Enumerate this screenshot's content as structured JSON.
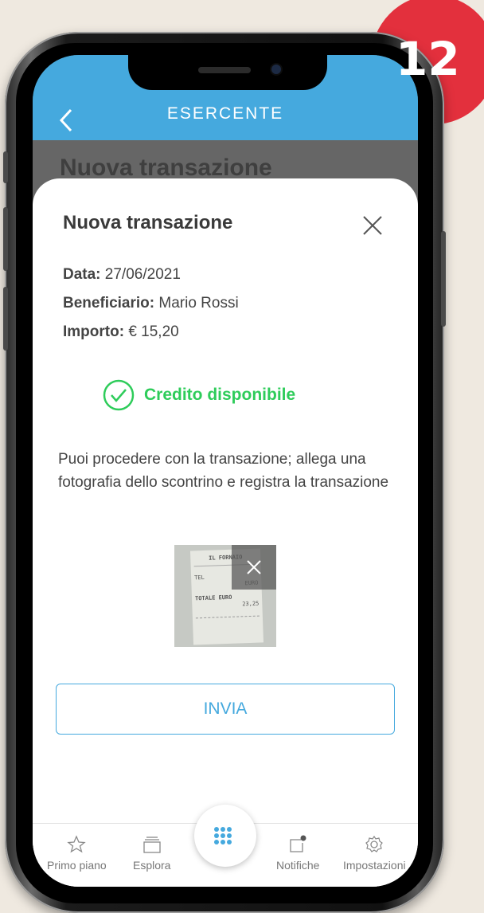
{
  "header": {
    "title": "ESERCENTE"
  },
  "background_title": "Nuova transazione",
  "modal": {
    "title": "Nuova transazione",
    "date_label": "Data:",
    "date_value": "27/06/2021",
    "beneficiary_label": "Beneficiario:",
    "beneficiary_value": "Mario Rossi",
    "amount_label": "Importo:",
    "amount_value": "€ 15,20",
    "status": "Credito disponibile",
    "description": "Puoi procedere con la transazione; allega una fotografia dello scontrino e registra la transazione",
    "send_label": "INVIA"
  },
  "receipt_text": [
    "IL FORNAIO",
    "TEL",
    "EURO",
    "TOTALE EURO",
    "23,25"
  ],
  "tabs": [
    {
      "label": "Primo piano",
      "icon": "star-icon"
    },
    {
      "label": "Esplora",
      "icon": "layers-icon"
    },
    {
      "label": "",
      "icon": "grid-icon"
    },
    {
      "label": "Notifiche",
      "icon": "notification-icon"
    },
    {
      "label": "Impostazioni",
      "icon": "gear-icon"
    }
  ],
  "step_badge": "12",
  "colors": {
    "accent": "#45a9de",
    "success": "#2ecc5a",
    "badge": "#e3303d"
  }
}
